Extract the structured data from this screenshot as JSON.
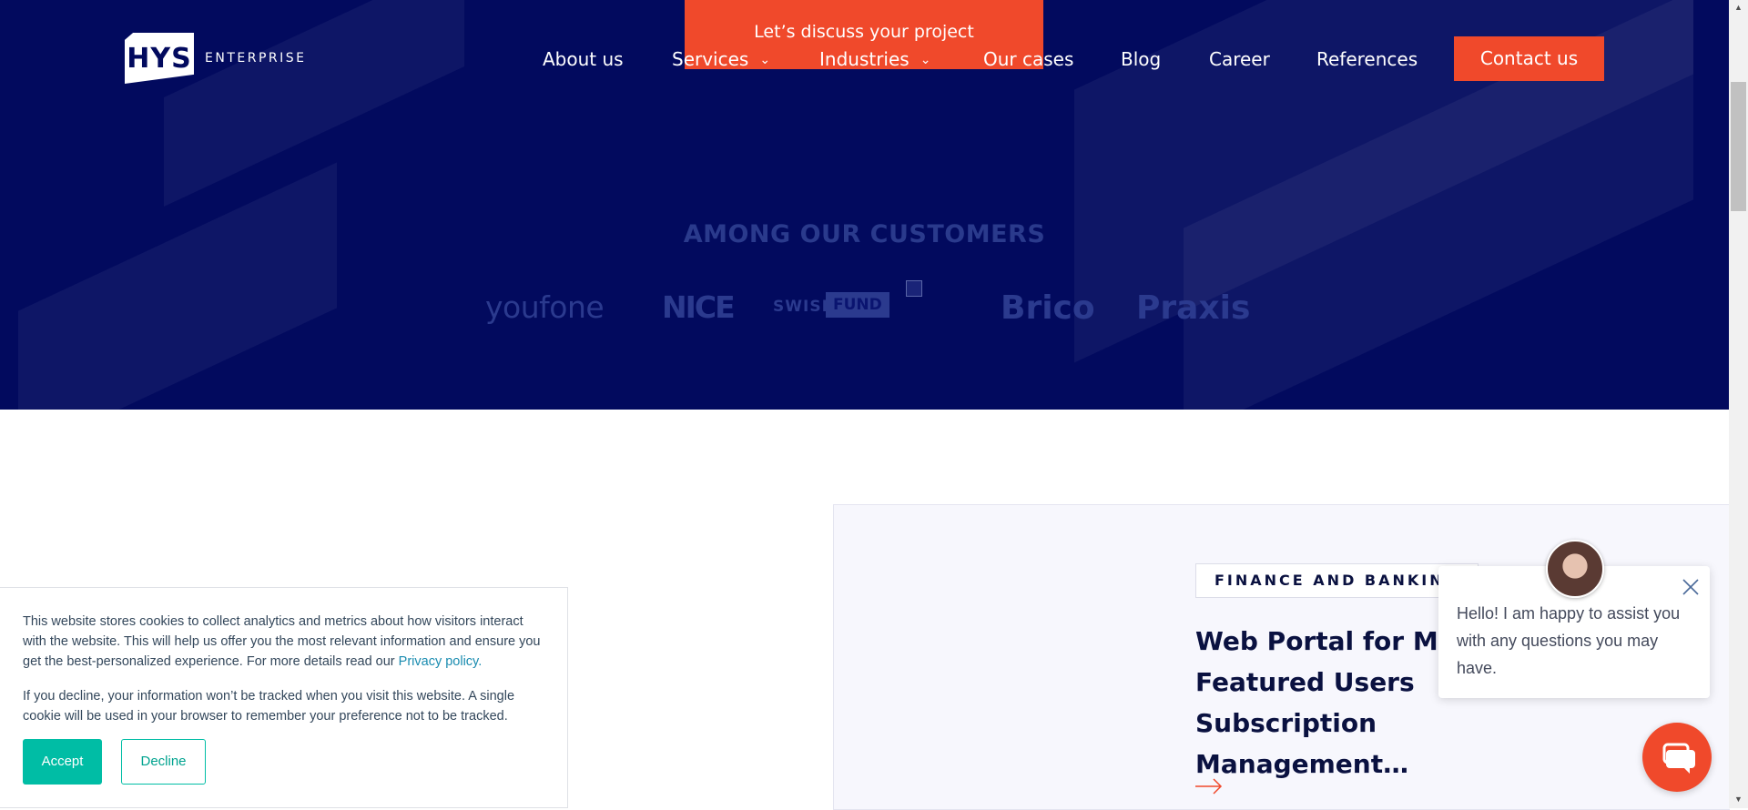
{
  "header": {
    "logo_mark": "HYS",
    "logo_text": "ENTERPRISE",
    "cta_banner": "Let’s discuss your project",
    "nav": [
      {
        "label": "About us"
      },
      {
        "label": "Services",
        "has_dropdown": true
      },
      {
        "label": "Industries",
        "has_dropdown": true
      },
      {
        "label": "Our cases"
      },
      {
        "label": "Blog"
      },
      {
        "label": "Career"
      },
      {
        "label": "References"
      }
    ],
    "contact_label": "Contact us"
  },
  "customers": {
    "title": "AMONG OUR CUSTOMERS",
    "logos": [
      "youfone",
      "NICE",
      "SWISH",
      "FUND",
      "Brico",
      "Praxis"
    ]
  },
  "case_card": {
    "tag": "FINANCE AND BANKING",
    "title": "Web Portal for Merc Full-Featured Users Subscription Management…"
  },
  "chat": {
    "greeting": "Hello! I am happy to assist you with any questions you may have."
  },
  "cookie_banner": {
    "text1": "This website stores cookies to collect analytics and metrics about how visitors interact with the website. This will help us offer you the most relevant information and ensure you get the best-personalized experience. For more details read our ",
    "privacy_link": "Privacy policy",
    "text1_end": ".",
    "text2": "If you decline, your information won’t be tracked when you visit this website. A single cookie will be used in your browser to remember your preference not to be tracked.",
    "accept_label": "Accept",
    "decline_label": "Decline"
  },
  "colors": {
    "hero_bg": "#020a5e",
    "accent": "#f0492b",
    "cookie_accent": "#00bda5",
    "text_dark": "#0a1140"
  }
}
